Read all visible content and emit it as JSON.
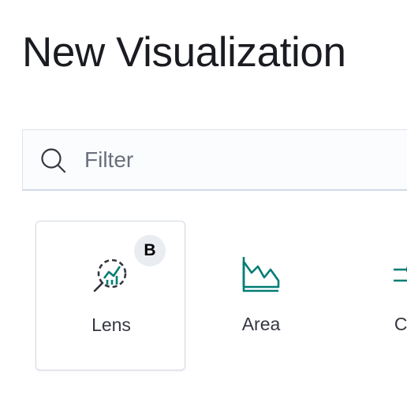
{
  "page": {
    "title": "New Visualization"
  },
  "search": {
    "placeholder": "Filter",
    "value": "",
    "icon": "search-icon"
  },
  "visualizations": [
    {
      "label": "Lens",
      "icon": "lens-icon",
      "badge": "B",
      "selected": true
    },
    {
      "label": "Area",
      "icon": "area-chart-icon"
    },
    {
      "label": "Con",
      "icon": "controls-icon"
    }
  ],
  "colors": {
    "accent": "#017d73",
    "text": "#343741",
    "title": "#1a1c21",
    "badge_bg": "#e9ecf1"
  }
}
